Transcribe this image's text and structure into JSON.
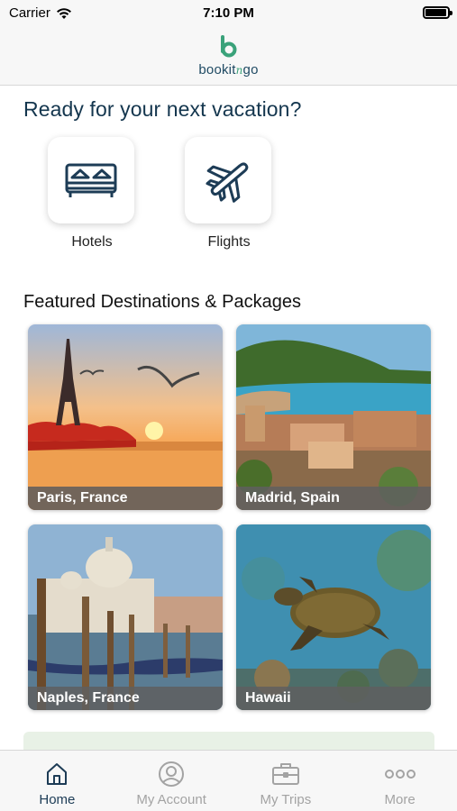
{
  "status_bar": {
    "carrier": "Carrier",
    "time": "7:10 PM",
    "battery_level": 0.9
  },
  "header": {
    "logo_text": "bookit",
    "logo_connector": "n",
    "logo_suffix": "go"
  },
  "main": {
    "headline": "Ready for your next vacation?",
    "categories": [
      {
        "label": "Hotels",
        "icon": "bed-icon"
      },
      {
        "label": "Flights",
        "icon": "airplane-icon"
      }
    ],
    "featured_title": "Featured Destinations & Packages",
    "destinations": [
      {
        "name": "Paris, France"
      },
      {
        "name": "Madrid, Spain"
      },
      {
        "name": "Naples, France"
      },
      {
        "name": "Hawaii"
      }
    ]
  },
  "tab_bar": {
    "tabs": [
      {
        "label": "Home",
        "icon": "home-icon",
        "active": true
      },
      {
        "label": "My Account",
        "icon": "account-icon",
        "active": false
      },
      {
        "label": "My Trips",
        "icon": "briefcase-icon",
        "active": false
      },
      {
        "label": "More",
        "icon": "more-icon",
        "active": false
      }
    ]
  },
  "colors": {
    "brand_dark": "#1d3c56",
    "brand_green": "#3aa27a",
    "tab_inactive": "#a3a3a3"
  }
}
